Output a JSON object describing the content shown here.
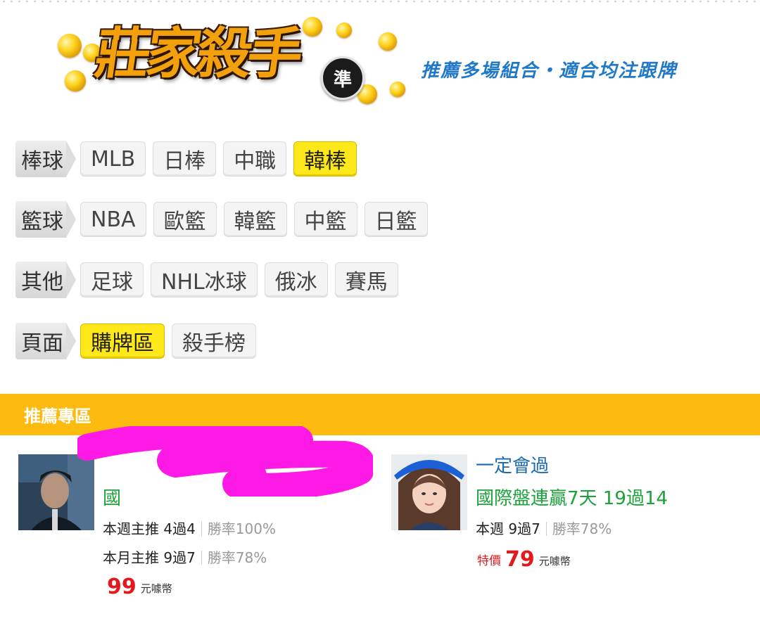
{
  "header": {
    "logo_text": "莊家殺手",
    "logo_badge": "準",
    "tagline": "推薦多場組合・適合均注跟牌"
  },
  "categories": [
    {
      "label": "棒球",
      "items": [
        {
          "label": "MLB",
          "active": false
        },
        {
          "label": "日棒",
          "active": false
        },
        {
          "label": "中職",
          "active": false
        },
        {
          "label": "韓棒",
          "active": true
        }
      ]
    },
    {
      "label": "籃球",
      "items": [
        {
          "label": "NBA",
          "active": false
        },
        {
          "label": "歐籃",
          "active": false
        },
        {
          "label": "韓籃",
          "active": false
        },
        {
          "label": "中籃",
          "active": false
        },
        {
          "label": "日籃",
          "active": false
        }
      ]
    },
    {
      "label": "其他",
      "items": [
        {
          "label": "足球",
          "active": false
        },
        {
          "label": "NHL冰球",
          "active": false
        },
        {
          "label": "俄冰",
          "active": false
        },
        {
          "label": "賽馬",
          "active": false
        }
      ]
    },
    {
      "label": "頁面",
      "items": [
        {
          "label": "購牌區",
          "active": true
        },
        {
          "label": "殺手榜",
          "active": false
        }
      ]
    }
  ],
  "section": {
    "title": "推薦專區"
  },
  "cards": [
    {
      "headline_visible": "國",
      "week_label": "本週主推 4過4",
      "week_rate": "勝率100%",
      "month_label": "本月主推 9過7",
      "month_rate": "勝率78%",
      "price_value": "99",
      "price_unit": "元噱幣"
    },
    {
      "name": "一定會過",
      "headline": "國際盤連贏7天 19過14",
      "week_label": "本週 9過7",
      "week_rate": "勝率78%",
      "price_tag": "特價",
      "price_value": "79",
      "price_unit": "元噱幣"
    }
  ],
  "colors": {
    "accent_yellow": "#fdbb0f",
    "active_pill": "#ffe81a",
    "link_blue": "#1a6ab2",
    "green": "#1ba23a",
    "price_red": "#e3191c",
    "redaction_magenta": "#ff19e6"
  },
  "icons": {
    "coins": "gold-coin-icon",
    "badge": "zhun-badge-icon"
  }
}
